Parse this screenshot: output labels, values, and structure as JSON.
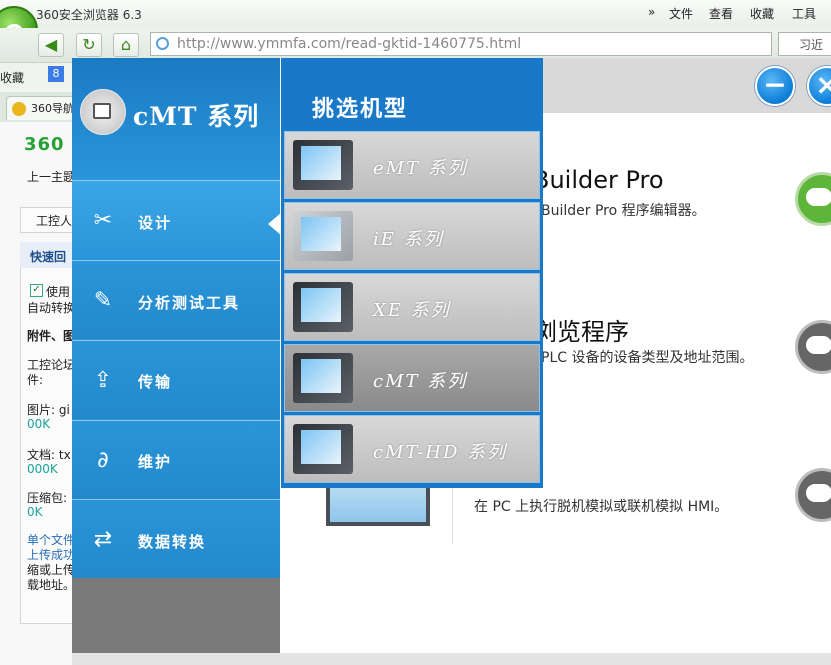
{
  "browser": {
    "title": "360安全浏览器 6.3",
    "menu": [
      "文件",
      "查看",
      "收藏",
      "工具"
    ],
    "menu_chevron": "»",
    "url_host": "http://www.ymmfa.com",
    "url_path": "/read-gktid-1460775.html",
    "search_placeholder": "习近",
    "favorites_label": "收藏",
    "tab_label": "360导航"
  },
  "left_page": {
    "brand": "360",
    "lines": [
      "上一主题",
      "工控人",
      "快速回",
      "使用",
      "自动转换",
      "附件、图",
      "工控论坛",
      "件:",
      "图片: gi",
      "00K",
      "文档: tx",
      "000K",
      "压缩包:",
      "0K",
      "单个文件",
      "上传成功",
      "缩或上传",
      "载地址。"
    ]
  },
  "app": {
    "minimize_icon": "−",
    "close_icon": "×",
    "series_title": "cMT 系列",
    "sidebar": [
      {
        "label": "设计",
        "icon": "design-icon",
        "glyph": "✂"
      },
      {
        "label": "分析测试工具",
        "icon": "analysis-icon",
        "glyph": "✎"
      },
      {
        "label": "传输",
        "icon": "transfer-icon",
        "glyph": "⇪"
      },
      {
        "label": "维护",
        "icon": "maintenance-icon",
        "glyph": "∂"
      },
      {
        "label": "数据转换",
        "icon": "data-convert-icon",
        "glyph": "⇄"
      }
    ],
    "picker_title": "挑选机型",
    "models": [
      {
        "label": "eMT 系列",
        "selected": false
      },
      {
        "label": "iE 系列",
        "selected": false
      },
      {
        "label": "XE 系列",
        "selected": false
      },
      {
        "label": "cMT 系列",
        "selected": true
      },
      {
        "label": "cMT-HD 系列",
        "selected": false
      }
    ],
    "items": [
      {
        "title": "Builder Pro",
        "desc": "Builder Pro 程序编辑器。"
      },
      {
        "title": "浏览程序",
        "desc": "PLC 设备的设备类型及地址范围。"
      },
      {
        "desc": "在 PC 上执行脱机模拟或联机模拟 HMI。"
      }
    ]
  },
  "colors": {
    "sidebar_blue": "#2a95d8",
    "picker_blue": "#1a78c8",
    "accent_green": "#5db53a"
  }
}
